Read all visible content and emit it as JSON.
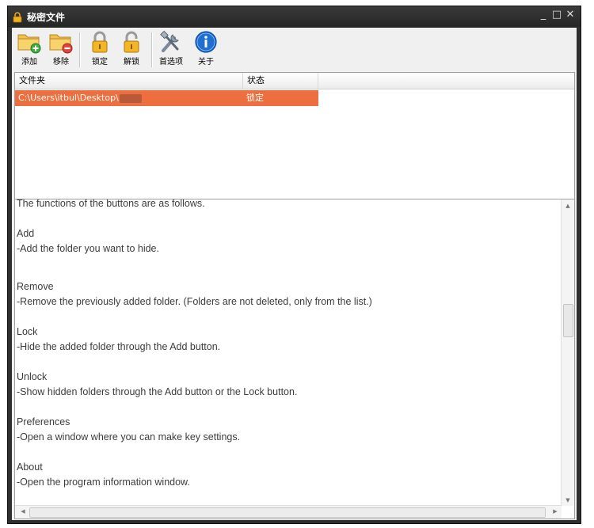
{
  "window": {
    "title": "秘密文件",
    "controls": [
      "_",
      "□",
      "✕"
    ]
  },
  "toolbar": {
    "buttons": [
      {
        "id": "add",
        "label": "添加",
        "icon": "folder-add-icon"
      },
      {
        "id": "remove",
        "label": "移除",
        "icon": "folder-remove-icon"
      },
      {
        "id": "lock",
        "label": "锁定",
        "icon": "lock-closed-icon"
      },
      {
        "id": "unlock",
        "label": "解锁",
        "icon": "lock-open-icon"
      },
      {
        "id": "preferences",
        "label": "首选项",
        "icon": "tools-icon"
      },
      {
        "id": "about",
        "label": "关于",
        "icon": "info-icon"
      }
    ]
  },
  "list": {
    "columns": [
      "文件夹",
      "状态"
    ],
    "rows": [
      {
        "folder": "C:\\Users\\itbul\\Desktop\\",
        "status": "锁定",
        "selected": true
      }
    ]
  },
  "description": {
    "lines": [
      "The functions of the buttons are as follows.",
      "Add",
      "-Add the folder you want to hide.",
      "Remove",
      "-Remove the previously added folder. (Folders are not deleted, only from the list.)",
      "Lock",
      "-Hide the added folder through the Add button.",
      "Unlock",
      "-Show hidden folders through the Add button or the Lock button.",
      "Preferences",
      "-Open a window where you can make key settings.",
      "About",
      "-Open the program information window."
    ]
  },
  "colors": {
    "selection": "#ed6f3f",
    "titlebar": "#2f2f2f",
    "lock_icon": "#f0b020",
    "info_icon": "#1e6fd0"
  }
}
